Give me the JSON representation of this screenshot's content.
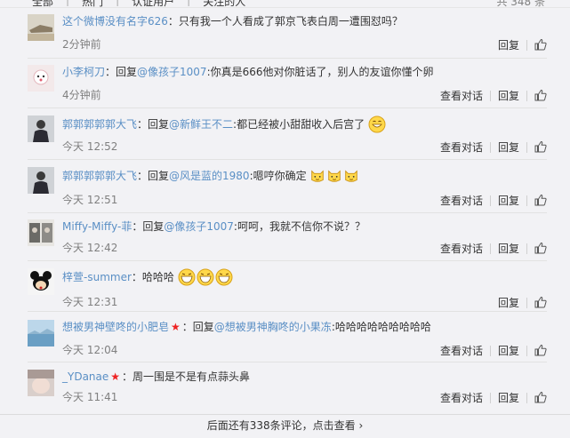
{
  "header": {
    "tabs": [
      "全部",
      "热门",
      "认证用户",
      "关注的人"
    ],
    "total": "共 348 条"
  },
  "actions": {
    "conversation": "查看对话",
    "reply": "回复"
  },
  "comments": [
    {
      "user": "这个微博没有名字626",
      "user_suffix": "：",
      "reply_prefix": "",
      "mention": "",
      "text": "只有我一个人看成了郭京飞表白周一遭围怼吗？",
      "time": "2分钟前",
      "has_conversation": false
    },
    {
      "user": "小李柯刀",
      "user_suffix": "：回复",
      "mention": "@像孩子1007",
      "text": ":你真是666他对你脏话了，别人的友谊你懂个卵",
      "time": "4分钟前",
      "has_conversation": true
    },
    {
      "user": "郭郭郭郭郭大飞",
      "user_suffix": "：回复",
      "mention": "@新鲜王不二",
      "text": ":都已经被小甜甜收入后宫了",
      "time": "今天 12:52",
      "has_conversation": true
    },
    {
      "user": "郭郭郭郭郭大飞",
      "user_suffix": "：回复",
      "mention": "@风是蓝的1980",
      "text": ":嗯哼你确定",
      "time": "今天 12:51",
      "has_conversation": true
    },
    {
      "user": "Miffy-Miffy-菲",
      "user_suffix": "：回复",
      "mention": "@像孩子1007",
      "text": ":呵呵，我就不信你不说？？",
      "time": "今天 12:42",
      "has_conversation": true
    },
    {
      "user": "梓萱-summer",
      "user_suffix": "：",
      "mention": "",
      "text": "哈哈哈",
      "time": "今天 12:31",
      "has_conversation": false
    },
    {
      "user": "想被男神壁咚的小肥皂",
      "user_suffix": "：回复",
      "mention": "@想被男神胸咚的小果冻",
      "text": ":哈哈哈哈哈哈哈哈哈",
      "time": "今天 12:04",
      "has_conversation": true
    },
    {
      "user": "_YDanae",
      "user_suffix": "：",
      "mention": "",
      "text": "周一围是不是有点蒜头鼻",
      "time": "今天 11:41",
      "has_conversation": true
    }
  ],
  "footer": {
    "more": "后面还有338条评论，点击查看 ›"
  }
}
